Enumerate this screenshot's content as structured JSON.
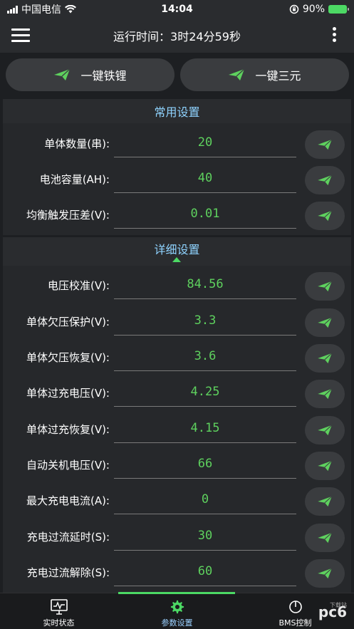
{
  "status_bar": {
    "carrier": "中国电信",
    "time": "14:04",
    "battery": "90%"
  },
  "header": {
    "title": "运行时间：3时24分59秒"
  },
  "quick_buttons": [
    {
      "label": "一键铁锂"
    },
    {
      "label": "一键三元"
    }
  ],
  "common_section": {
    "title": "常用设置",
    "rows": [
      {
        "label": "单体数量(串):",
        "value": "20"
      },
      {
        "label": "电池容量(AH):",
        "value": "40"
      },
      {
        "label": "均衡触发压差(V):",
        "value": "0.01"
      }
    ]
  },
  "detail_section": {
    "title": "详细设置",
    "rows": [
      {
        "label": "电压校准(V):",
        "value": "84.56"
      },
      {
        "label": "单体欠压保护(V):",
        "value": "3.3"
      },
      {
        "label": "单体欠压恢复(V):",
        "value": "3.6"
      },
      {
        "label": "单体过充电压(V):",
        "value": "4.25"
      },
      {
        "label": "单体过充恢复(V):",
        "value": "4.15"
      },
      {
        "label": "自动关机电压(V):",
        "value": "66"
      },
      {
        "label": "最大充电电流(A):",
        "value": "0"
      },
      {
        "label": "充电过流延时(S):",
        "value": "30"
      },
      {
        "label": "充电过流解除(S):",
        "value": "60"
      }
    ]
  },
  "tabbar": {
    "tabs": [
      {
        "label": "实时状态",
        "icon": "monitor-icon"
      },
      {
        "label": "参数设置",
        "icon": "gear-icon"
      },
      {
        "label": "BMS控制",
        "icon": "control-icon"
      }
    ],
    "active_index": 1,
    "watermark": "pc6",
    "watermark_sub": "下载站"
  },
  "colors": {
    "accent_green": "#5ed15e",
    "section_title": "#8fd3ff",
    "background": "#1d1f22"
  }
}
